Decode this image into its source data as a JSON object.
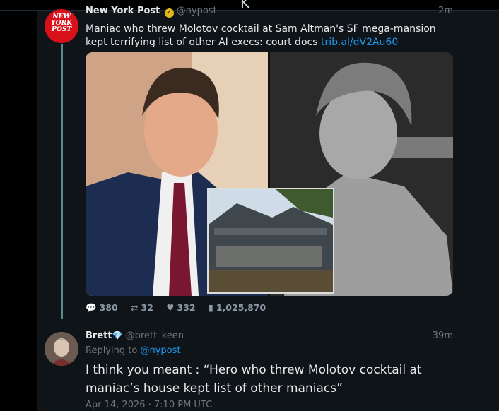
{
  "topbar": {
    "glyph": "K"
  },
  "post": {
    "author_name": "New York Post",
    "author_handle": "@nypost",
    "time": "2m",
    "avatar_text": "NEW YORK POST",
    "text": "Maniac who threw Molotov cocktail at Sam Altman's SF mega-mansion kept terrifying list of other AI execs: court docs ",
    "link": "trib.al/dV2Au60",
    "stats": {
      "replies": "380",
      "reposts": "32",
      "likes": "332",
      "views": "1,025,870"
    }
  },
  "reply": {
    "author_name": "Brett",
    "author_handle": "@brett_keen",
    "time": "39m",
    "replying_prefix": "Replying to ",
    "replying_to": "@nypost",
    "text": "I think you meant : “Hero who threw Molotov cocktail at maniac’s house kept list of other maniacs”",
    "date": "Apr 14, 2026 · 7:10 PM UTC"
  },
  "icons": {
    "reply": "speech-bubble-icon",
    "repost": "repost-icon",
    "like": "heart-icon",
    "views": "bar-chart-icon",
    "verified": "verified-badge-icon",
    "gem": "diamond-icon"
  },
  "colors": {
    "link": "#1d9bf0",
    "verified": "#e2b719",
    "brand_red": "#d8101a",
    "thread_line": "#5a8a8c"
  }
}
